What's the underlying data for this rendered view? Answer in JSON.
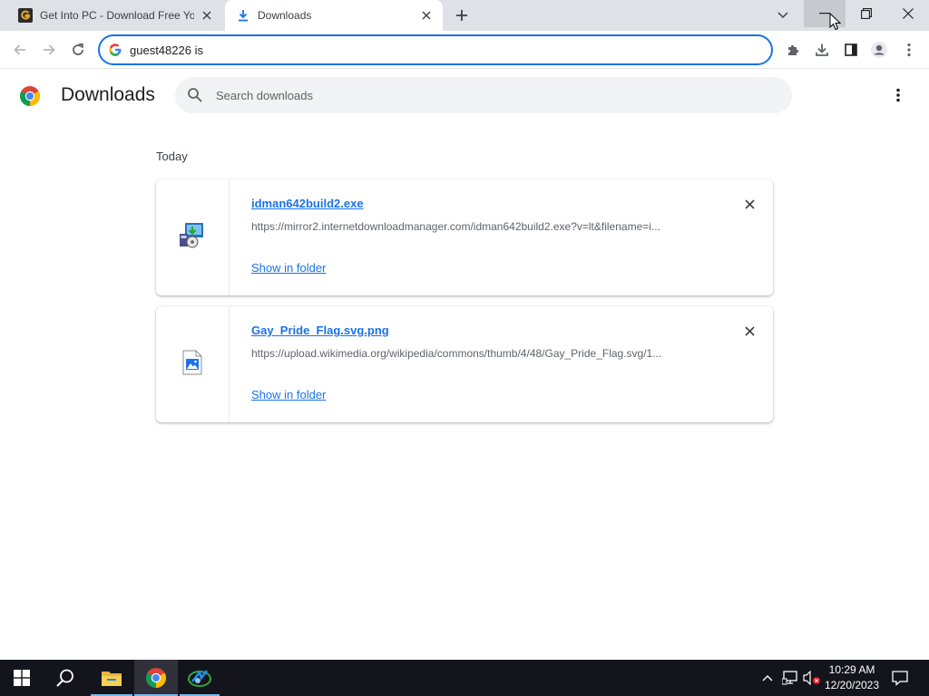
{
  "tabs": [
    {
      "title": "Get Into PC - Download Free Your Desired App",
      "active": false
    },
    {
      "title": "Downloads",
      "active": true
    }
  ],
  "omnibox": {
    "text": "guest48226 is"
  },
  "downloads_page": {
    "title": "Downloads",
    "search_placeholder": "Search downloads",
    "section_date": "Today",
    "items": [
      {
        "filename": "idman642build2.exe",
        "url": "https://mirror2.internetdownloadmanager.com/idman642build2.exe?v=lt&filename=i...",
        "action": "Show in folder",
        "icon": "installer-icon"
      },
      {
        "filename": "Gay_Pride_Flag.svg.png",
        "url": "https://upload.wikimedia.org/wikipedia/commons/thumb/4/48/Gay_Pride_Flag.svg/1...",
        "action": "Show in folder",
        "icon": "image-file-icon"
      }
    ]
  },
  "taskbar": {
    "time": "10:29 AM",
    "date": "12/20/2023"
  },
  "colors": {
    "accent": "#1a73e8",
    "tabbar": "#dee1e6",
    "taskbar": "#14141d"
  }
}
